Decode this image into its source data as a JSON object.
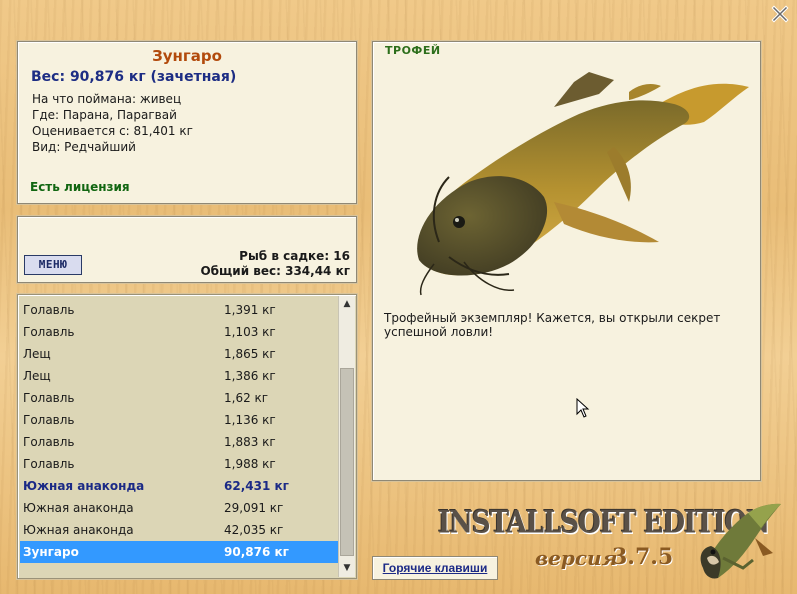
{
  "fish_info": {
    "name": "Зунгаро",
    "weight_line": "Вес: 90,876 кг (зачетная)",
    "bait_line": "На что поймана: живец",
    "place_line": "Где: Парана, Парагвай",
    "value_line": "Оценивается с: 81,401 кг",
    "kind_line": "Вид: Редчайший",
    "license": "Есть лицензия"
  },
  "cage": {
    "menu_label": "МЕНЮ",
    "count_line": "Рыб в садке: 16",
    "total_weight_line": "Общий вес: 334,44 кг"
  },
  "catch_list": [
    {
      "name": "Голавль",
      "weight": "1,391 кг",
      "style": "normal"
    },
    {
      "name": "Голавль",
      "weight": "1,103 кг",
      "style": "normal"
    },
    {
      "name": "Лещ",
      "weight": "1,865 кг",
      "style": "normal"
    },
    {
      "name": "Лещ",
      "weight": "1,386 кг",
      "style": "normal"
    },
    {
      "name": "Голавль",
      "weight": "1,62 кг",
      "style": "normal"
    },
    {
      "name": "Голавль",
      "weight": "1,136 кг",
      "style": "normal"
    },
    {
      "name": "Голавль",
      "weight": "1,883 кг",
      "style": "normal"
    },
    {
      "name": "Голавль",
      "weight": "1,988 кг",
      "style": "normal"
    },
    {
      "name": "Южная анаконда",
      "weight": "62,431 кг",
      "style": "bold"
    },
    {
      "name": "Южная анаконда",
      "weight": "29,091 кг",
      "style": "normal"
    },
    {
      "name": "Южная анаконда",
      "weight": "42,035 кг",
      "style": "normal"
    },
    {
      "name": "Зунгаро",
      "weight": "90,876 кг",
      "style": "selected"
    }
  ],
  "trophy": {
    "label": "ТРОФЕЙ",
    "text": "Трофейный экземпляр! Кажется, вы открыли секрет успешной ловли!"
  },
  "footer": {
    "hotkeys_label": "Горячие клавиши",
    "edition": "INSTALLSOFT EDITION",
    "version_prefix": "версия",
    "version_number": "3.7.5"
  },
  "icons": {
    "close": "close-icon",
    "fish_image": "zungaro-fish-image",
    "logo": "pike-logo",
    "cursor": "mouse-cursor-icon"
  },
  "colors": {
    "fish_name": "#b24a0c",
    "weight_line": "#1d2d84",
    "license": "#116611",
    "trophy_label": "#2c6e1b",
    "selection": "#3399ff",
    "panel_bg": "#f7f2df"
  }
}
